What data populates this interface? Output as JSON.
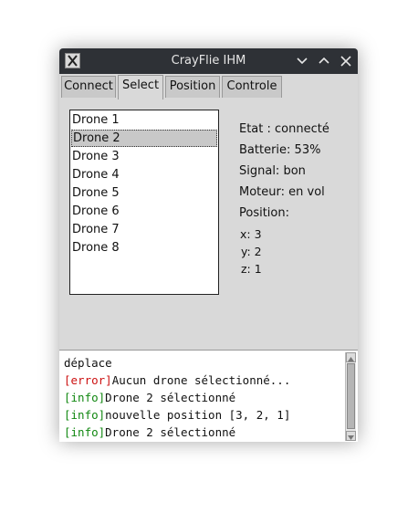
{
  "window": {
    "title": "CrayFlie IHM"
  },
  "tabs": [
    {
      "label": "Connect"
    },
    {
      "label": "Select"
    },
    {
      "label": "Position"
    },
    {
      "label": "Controle"
    }
  ],
  "drone_list": {
    "items": [
      "Drone 1",
      "Drone 2",
      "Drone 3",
      "Drone 4",
      "Drone 5",
      "Drone 6",
      "Drone 7",
      "Drone 8"
    ],
    "selected": "Drone 2"
  },
  "status": {
    "etat": "Etat : connecté",
    "batterie": "Batterie: 53%",
    "signal": "Signal: bon",
    "moteur": "Moteur: en vol",
    "position_label": "Position:",
    "x": "x: 3",
    "y": "y: 2",
    "z": "z: 1"
  },
  "console": {
    "lines": [
      {
        "tag": "",
        "text": "déplace"
      },
      {
        "tag": "[error]",
        "text": "Aucun drone sélectionné..."
      },
      {
        "tag": "[info]",
        "text": "Drone 2 sélectionné"
      },
      {
        "tag": "[info]",
        "text": "nouvelle position [3, 2, 1]"
      },
      {
        "tag": "[info]",
        "text": "Drone 2 sélectionné"
      }
    ]
  },
  "colors": {
    "error": "#cc1111",
    "info": "#118811",
    "titlebar": "#2e3136"
  },
  "icons": [
    "app-icon",
    "minimize-icon",
    "maximize-icon",
    "close-icon",
    "scroll-up-icon",
    "scroll-down-icon"
  ]
}
